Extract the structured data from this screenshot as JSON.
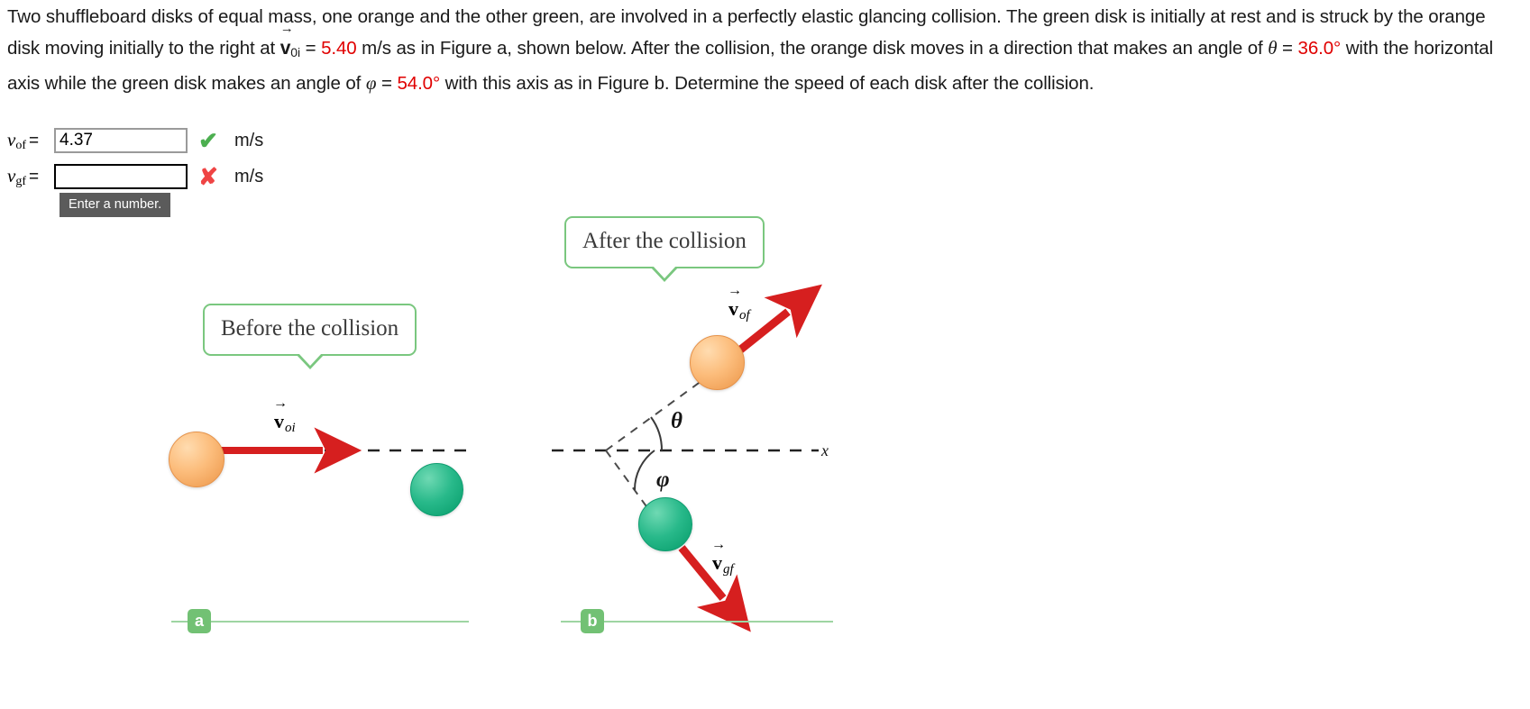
{
  "problem": {
    "line1_a": "Two shuffleboard disks of equal mass, one orange and the other green, are involved in a perfectly elastic glancing collision. The green disk is initially at rest and is struck by the orange disk moving initially to the right at ",
    "v0i_symbol": "v",
    "v0i_sub": "0i",
    "v0i_eq": " = ",
    "v0i_value": "5.40",
    "v0i_unit": " m/s ",
    "line1_b": "as in Figure a, shown below. After the collision, the orange disk moves in a direction that makes an angle of ",
    "theta_symbol": "θ",
    "theta_eq": " = ",
    "theta_value": "36.0°",
    "line1_c": " with the horizontal axis while the green disk makes an angle of ",
    "phi_symbol": "φ",
    "phi_eq": " = ",
    "phi_value": "54.0°",
    "line1_d": " with this axis as in Figure b. Determine the speed of each disk after the collision."
  },
  "answers": {
    "rows": [
      {
        "var": "v",
        "sub": "of",
        "equals": "=",
        "value": "4.37",
        "placeholder": "",
        "mark": "✔",
        "mark_state": "correct",
        "unit": "m/s"
      },
      {
        "var": "v",
        "sub": "gf",
        "equals": "=",
        "value": "",
        "placeholder": "",
        "mark": "✘",
        "mark_state": "incorrect",
        "unit": "m/s"
      }
    ],
    "tooltip": "Enter a number."
  },
  "figure_a": {
    "callout": "Before the collision",
    "vector_label": {
      "symbol": "v",
      "sub": "oi"
    },
    "badge": "a",
    "disks": [
      {
        "color_name": "orange",
        "hex": "#f8b978"
      },
      {
        "color_name": "green",
        "hex": "#1fb487"
      }
    ]
  },
  "figure_b": {
    "callout": "After the collision",
    "vector_label_orange": {
      "symbol": "v",
      "sub": "of"
    },
    "vector_label_green": {
      "symbol": "v",
      "sub": "gf"
    },
    "angle_theta": "θ",
    "angle_phi": "φ",
    "axis_label": "x",
    "badge": "b",
    "disks": [
      {
        "color_name": "orange",
        "hex": "#f8b978"
      },
      {
        "color_name": "green",
        "hex": "#1fb487"
      }
    ]
  },
  "colors": {
    "arrow_red": "#d61f1f",
    "callout_border": "#7ac77f",
    "badge_green": "#72c174",
    "highlight_red": "#e00000",
    "correct_green": "#4caf50",
    "incorrect_red": "#ef4444",
    "tooltip_bg": "#5b5b5b"
  }
}
